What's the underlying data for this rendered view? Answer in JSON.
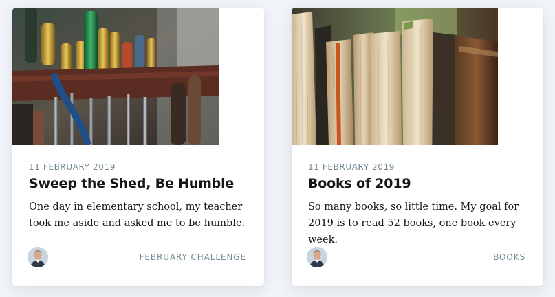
{
  "posts": [
    {
      "image": "workshop-tools-photo",
      "date": "11 FEBRUARY 2019",
      "title": "Sweep the Shed, Be Humble",
      "excerpt": "One day in elementary school, my teacher took me aside and asked me to be humble.",
      "tag": "FEBRUARY CHALLENGE",
      "author_avatar": "author-avatar-photo"
    },
    {
      "image": "stacked-books-photo",
      "date": "11 FEBRUARY 2019",
      "title": "Books of 2019",
      "excerpt": "So many books, so little time. My goal for 2019 is to read 52 books, one book every week.",
      "tag": "BOOKS",
      "author_avatar": "author-avatar-photo"
    }
  ],
  "colors": {
    "page_background": "#f1f4f8",
    "card_background": "#ffffff",
    "meta_text": "#738a94",
    "title_text": "#15171a"
  }
}
